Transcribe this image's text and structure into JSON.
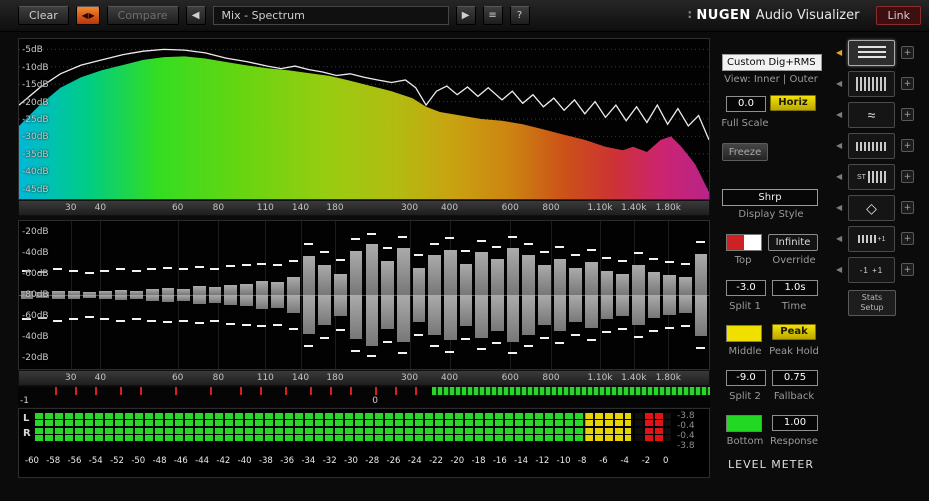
{
  "toolbar": {
    "clear": "Clear",
    "compare": "Compare",
    "preset": "Mix - Spectrum",
    "help": "?",
    "link": "Link",
    "brand_dots": "∶",
    "brand_name": "NUGEN",
    "brand_product": "Audio Visualizer",
    "icons": {
      "swap": "◀ ▶",
      "prev": "◀",
      "play": "▶",
      "list": "≡"
    }
  },
  "panels": {
    "spectrum_db_labels": [
      "-5dB",
      "-10dB",
      "-15dB",
      "-20dB",
      "-25dB",
      "-30dB",
      "-35dB",
      "-40dB",
      "-45dB"
    ],
    "bar_db_labels": [
      "-20dB",
      "-40dB",
      "-60dB",
      "-80dB",
      "-60dB",
      "-40dB",
      "-20dB"
    ],
    "freq_labels": [
      [
        "30",
        0.075
      ],
      [
        "40",
        0.118
      ],
      [
        "60",
        0.23
      ],
      [
        "80",
        0.289
      ],
      [
        "110",
        0.357
      ],
      [
        "140",
        0.408
      ],
      [
        "180",
        0.458
      ],
      [
        "300",
        0.566
      ],
      [
        "400",
        0.624
      ],
      [
        "600",
        0.712
      ],
      [
        "800",
        0.771
      ],
      [
        "1.10k",
        0.842
      ],
      [
        "1.40k",
        0.891
      ],
      [
        "1.80k",
        0.941
      ]
    ],
    "correlation": {
      "min": "-1",
      "zero": "0"
    }
  },
  "controls": {
    "mode": "Custom Dig+RMS",
    "view": "View: Inner | Outer",
    "full_scale_value": "0.0",
    "horiz": "Horiz",
    "full_scale_label": "Full Scale",
    "freeze": "Freeze",
    "display_style_value": "Shrp",
    "display_style_label": "Display Style",
    "top_label": "Top",
    "infinite": "Infinite",
    "override_label": "Override",
    "split1_value": "-3.0",
    "split1_label": "Split 1",
    "time_value": "1.0s",
    "time_label": "Time",
    "middle_label": "Middle",
    "peak": "Peak",
    "peak_hold_label": "Peak Hold",
    "split2_value": "-9.0",
    "split2_label": "Split 2",
    "fallback_value": "0.75",
    "fallback_label": "Fallback",
    "bottom_label": "Bottom",
    "response_value": "1.00",
    "response_label": "Response",
    "meter_title": "LEVEL METER",
    "colors": {
      "top_swatch_left": "#cc2222",
      "top_swatch_right": "#ffffff",
      "middle_swatch": "#f0e000",
      "bottom_swatch": "#22d822",
      "accent_yellow": "#f0e000"
    }
  },
  "modes": {
    "arrow_glyph": "◀",
    "plus_glyph": "+",
    "stats_line1": "Stats",
    "stats_line2": "Setup",
    "rows": [
      {
        "icon": "spectrum-lines-icon",
        "selected": true
      },
      {
        "icon": "spectrogram-bars-icon"
      },
      {
        "icon": "waveform-icon",
        "glyph": "≈"
      },
      {
        "icon": "histogram-icon"
      },
      {
        "icon": "stereo-bars-icon",
        "text": "ST"
      },
      {
        "icon": "vectorscope-diamond-icon",
        "glyph": "◇"
      },
      {
        "icon": "mini-meters-icon",
        "text": "+1"
      },
      {
        "icon": "correlation-range-icon",
        "text": "-1 +1"
      }
    ]
  },
  "chart_data": [
    {
      "type": "area",
      "title": "RMS spectrum fill with peak line overlay",
      "ylim": [
        -48,
        -2
      ],
      "grid_db": [
        -5,
        -10,
        -15,
        -20,
        -25,
        -30,
        -35,
        -40,
        -45
      ],
      "gradient": [
        [
          0,
          "#00b8d8"
        ],
        [
          0.1,
          "#00cc85"
        ],
        [
          0.2,
          "#33dd22"
        ],
        [
          0.32,
          "#66d511"
        ],
        [
          0.45,
          "#99cc11"
        ],
        [
          0.55,
          "#b3bb11"
        ],
        [
          0.63,
          "#c9a211"
        ],
        [
          0.71,
          "#cc8511"
        ],
        [
          0.79,
          "#cc5218"
        ],
        [
          0.86,
          "#cc3333"
        ],
        [
          0.93,
          "#cc2470"
        ],
        [
          1,
          "#b82488"
        ]
      ],
      "inner": [
        [
          0,
          -27
        ],
        [
          0.03,
          -21
        ],
        [
          0.06,
          -16
        ],
        [
          0.09,
          -13
        ],
        [
          0.12,
          -11
        ],
        [
          0.15,
          -9.5
        ],
        [
          0.18,
          -8
        ],
        [
          0.21,
          -7.2
        ],
        [
          0.24,
          -7
        ],
        [
          0.27,
          -7.6
        ],
        [
          0.3,
          -8.6
        ],
        [
          0.33,
          -9.6
        ],
        [
          0.36,
          -10.4
        ],
        [
          0.39,
          -11
        ],
        [
          0.42,
          -11.8
        ],
        [
          0.45,
          -12.6
        ],
        [
          0.48,
          -14
        ],
        [
          0.51,
          -15.5
        ],
        [
          0.54,
          -17
        ],
        [
          0.57,
          -19
        ],
        [
          0.59,
          -21.5
        ],
        [
          0.61,
          -23
        ],
        [
          0.64,
          -24
        ],
        [
          0.67,
          -25
        ],
        [
          0.7,
          -25.5
        ],
        [
          0.73,
          -26.5
        ],
        [
          0.76,
          -28
        ],
        [
          0.79,
          -29.5
        ],
        [
          0.82,
          -31
        ],
        [
          0.85,
          -33
        ],
        [
          0.875,
          -34
        ],
        [
          0.89,
          -33
        ],
        [
          0.91,
          -34.5
        ],
        [
          0.93,
          -31
        ],
        [
          0.945,
          -30
        ],
        [
          0.96,
          -33
        ],
        [
          0.98,
          -38
        ],
        [
          1,
          -46
        ]
      ],
      "outer": [
        [
          0,
          -21
        ],
        [
          0.03,
          -16
        ],
        [
          0.06,
          -12
        ],
        [
          0.09,
          -9.5
        ],
        [
          0.12,
          -8
        ],
        [
          0.15,
          -6.5
        ],
        [
          0.18,
          -5.5
        ],
        [
          0.21,
          -5
        ],
        [
          0.24,
          -5.2
        ],
        [
          0.27,
          -6
        ],
        [
          0.3,
          -7.5
        ],
        [
          0.33,
          -8.5
        ],
        [
          0.36,
          -9.8
        ],
        [
          0.38,
          -10.5
        ],
        [
          0.4,
          -9.8
        ],
        [
          0.42,
          -10.8
        ],
        [
          0.44,
          -11.5
        ],
        [
          0.46,
          -12.5
        ],
        [
          0.48,
          -12
        ],
        [
          0.5,
          -13
        ],
        [
          0.52,
          -13.8
        ],
        [
          0.54,
          -14.5
        ],
        [
          0.56,
          -13.8
        ],
        [
          0.575,
          -16
        ],
        [
          0.59,
          -21
        ],
        [
          0.605,
          -17
        ],
        [
          0.62,
          -15.5
        ],
        [
          0.635,
          -18
        ],
        [
          0.65,
          -15.8
        ],
        [
          0.665,
          -18.5
        ],
        [
          0.68,
          -16
        ],
        [
          0.7,
          -19.5
        ],
        [
          0.715,
          -17
        ],
        [
          0.73,
          -20.5
        ],
        [
          0.745,
          -18
        ],
        [
          0.76,
          -21.5
        ],
        [
          0.775,
          -19
        ],
        [
          0.79,
          -22.5
        ],
        [
          0.805,
          -19.5
        ],
        [
          0.82,
          -23.5
        ],
        [
          0.835,
          -20
        ],
        [
          0.85,
          -24.5
        ],
        [
          0.865,
          -21
        ],
        [
          0.88,
          -25.5
        ],
        [
          0.895,
          -21.5
        ],
        [
          0.91,
          -26
        ],
        [
          0.925,
          -21
        ],
        [
          0.94,
          -26.5
        ],
        [
          0.955,
          -22
        ],
        [
          0.97,
          -27
        ],
        [
          0.985,
          -24
        ],
        [
          1,
          -31
        ]
      ]
    },
    {
      "type": "bar",
      "title": "Mirrored band energy bars",
      "values": [
        0.05,
        0.04,
        0.06,
        0.05,
        0.04,
        0.06,
        0.07,
        0.06,
        0.08,
        0.1,
        0.09,
        0.12,
        0.11,
        0.14,
        0.16,
        0.2,
        0.18,
        0.26,
        0.55,
        0.42,
        0.3,
        0.62,
        0.72,
        0.48,
        0.66,
        0.38,
        0.56,
        0.64,
        0.44,
        0.6,
        0.5,
        0.66,
        0.56,
        0.42,
        0.5,
        0.38,
        0.46,
        0.34,
        0.3,
        0.42,
        0.32,
        0.28,
        0.26,
        0.58
      ],
      "peaks": [
        0.3,
        0.28,
        0.32,
        0.3,
        0.27,
        0.3,
        0.32,
        0.3,
        0.33,
        0.34,
        0.32,
        0.35,
        0.33,
        0.36,
        0.38,
        0.4,
        0.38,
        0.44,
        0.68,
        0.56,
        0.45,
        0.74,
        0.82,
        0.62,
        0.78,
        0.52,
        0.68,
        0.76,
        0.58,
        0.72,
        0.64,
        0.78,
        0.68,
        0.56,
        0.63,
        0.52,
        0.59,
        0.48,
        0.44,
        0.55,
        0.46,
        0.42,
        0.4,
        0.7
      ]
    },
    {
      "type": "ticks",
      "title": "Band peak indicator strip",
      "red_ticks": [
        0.053,
        0.082,
        0.111,
        0.147,
        0.176,
        0.227,
        0.277,
        0.321,
        0.35,
        0.386,
        0.422,
        0.451,
        0.48,
        0.516,
        0.545,
        0.574
      ],
      "green_from": 0.598
    },
    {
      "type": "meter",
      "title": "Level meter",
      "channels": [
        "L",
        "R"
      ],
      "range_db": [
        -60,
        0
      ],
      "scale": [
        "-60",
        "-58",
        "-56",
        "-54",
        "-52",
        "-50",
        "-48",
        "-46",
        "-44",
        "-42",
        "-40",
        "-38",
        "-36",
        "-34",
        "-32",
        "-30",
        "-28",
        "-26",
        "-24",
        "-22",
        "-20",
        "-18",
        "-16",
        "-14",
        "-12",
        "-10",
        "-8",
        "-6",
        "-4",
        "-2",
        "0"
      ],
      "green_end_db": -8,
      "yellow_end_db": -3.8,
      "peak_block_db": [
        -2.6,
        -0.6
      ],
      "readouts": [
        "-3.8",
        "-0.4",
        "-0.4",
        "-3.8"
      ]
    }
  ]
}
